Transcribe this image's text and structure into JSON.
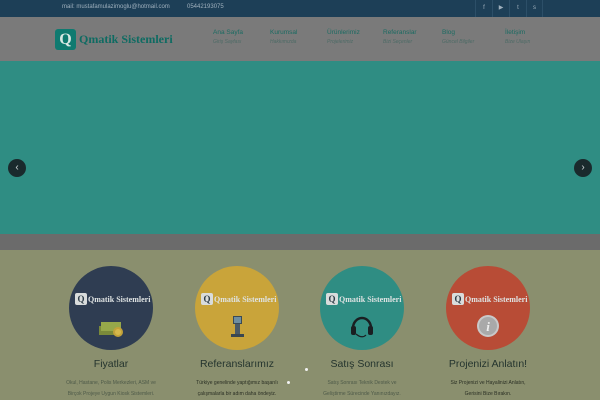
{
  "topbar": {
    "email": "mail: mustafamulazimoglu@hotmail.com",
    "phone": "05442193075",
    "social": [
      {
        "name": "facebook-icon",
        "glyph": "f"
      },
      {
        "name": "youtube-icon",
        "glyph": "▶"
      },
      {
        "name": "twitter-icon",
        "glyph": "t"
      },
      {
        "name": "skype-icon",
        "glyph": "s"
      }
    ]
  },
  "header": {
    "logo_letter": "Q",
    "logo_text": "Qmatik Sistemleri",
    "nav": [
      {
        "title": "Ana Sayfa",
        "sub": "Giriş Sayfası"
      },
      {
        "title": "Kurumsal",
        "sub": "Hakkımızda"
      },
      {
        "title": "Ürünlerimiz",
        "sub": "Projelerimiz"
      },
      {
        "title": "Referanslar",
        "sub": "Bizi Seçenler"
      },
      {
        "title": "Blog",
        "sub": "Güncel Bilgiler"
      },
      {
        "title": "İletişim",
        "sub": "Bize Ulaşın"
      }
    ]
  },
  "slider": {
    "prev_glyph": "‹",
    "next_glyph": "›"
  },
  "features": [
    {
      "title": "Fiyatlar",
      "logo_text": "Qmatik Sistemleri",
      "icon": "money-icon",
      "color": "#2f3d52",
      "lines": [
        "Okul, Hastane, Polis Merkezleri, ASM ve",
        "Birçok Projeye Uygun Kiosk Sistemleri."
      ]
    },
    {
      "title": "Referanslarımız",
      "logo_text": "Qmatik Sistemleri",
      "icon": "kiosk-icon",
      "color": "#c9a43a",
      "lines": [
        "Türkiye genelinde yaptığımız başarılı",
        "çalışmalarla bir adım daha öndeyiz."
      ]
    },
    {
      "title": "Satış Sonrası",
      "logo_text": "Qmatik Sistemleri",
      "icon": "headset-icon",
      "color": "#2f8d83",
      "lines": [
        "Satış Sonrası Teknik Destek ve",
        "Geliştirme Sürecinde Yanınızdayız."
      ]
    },
    {
      "title": "Projenizi Anlatın!",
      "logo_text": "Qmatik Sistemleri",
      "icon": "info-icon",
      "color": "#b84c36",
      "lines": [
        "Siz Projenizi ve Hayalinizi Anlatın,",
        "Gerisini Bize Bırakın."
      ]
    }
  ]
}
